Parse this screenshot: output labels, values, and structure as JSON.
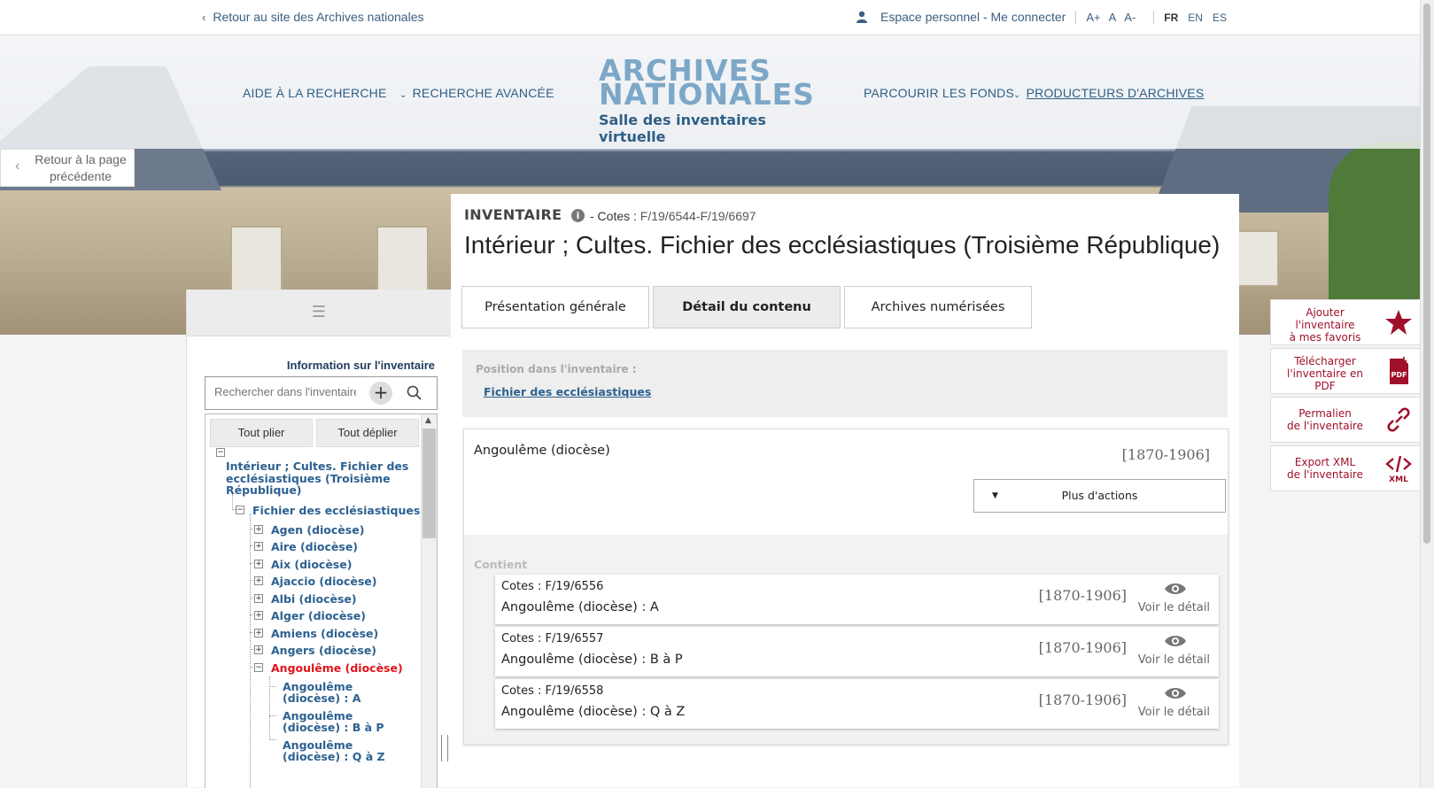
{
  "topbar": {
    "back_label": "Retour au site des Archives nationales",
    "account_label": "Espace personnel - Me connecter",
    "font_sizes": [
      "A+",
      "A",
      "A-"
    ],
    "languages": [
      "FR",
      "EN",
      "ES"
    ]
  },
  "nav": {
    "aide": "AIDE À LA RECHERCHE",
    "recherche_avancee": "RECHERCHE AVANCÉE",
    "parcourir": "PARCOURIR LES FONDS",
    "producteurs": "PRODUCTEURS D'ARCHIVES"
  },
  "logo": {
    "line1": "ARCHIVES",
    "line2": "NATIONALES",
    "subtitle": "Salle des inventaires virtuelle"
  },
  "prev_page": {
    "line1": "Retour à la page",
    "line2": "précédente"
  },
  "left_panel": {
    "info_link": "Information sur l'inventaire",
    "search_placeholder": "Rechercher dans l'inventaire",
    "collapse_all": "Tout plier",
    "expand_all": "Tout déplier",
    "tree_root": [
      "Intérieur ; Cultes. Fichier des",
      "ecclésiastiques (Troisième",
      "République)"
    ],
    "tree_level1": "Fichier des ecclésiastiques",
    "tree_items": [
      "Agen (diocèse)",
      "Aire (diocèse)",
      "Aix (diocèse)",
      "Ajaccio (diocèse)",
      "Albi (diocèse)",
      "Alger (diocèse)",
      "Amiens (diocèse)",
      "Angers (diocèse)",
      "Angoulême (diocèse)"
    ],
    "tree_sub_items": [
      [
        "Angoulême",
        "(diocèse) : A"
      ],
      [
        "Angoulême",
        "(diocèse) : B à P"
      ],
      [
        "Angoulême",
        "(diocèse) : Q à Z"
      ]
    ]
  },
  "main": {
    "kind": "INVENTAIRE",
    "cotes_label": "- Cotes :",
    "cotes_value": "F/19/6544-F/19/6697",
    "title": "Intérieur ; Cultes. Fichier des ecclésiastiques (Troisième République)",
    "tabs": [
      "Présentation générale",
      "Détail du contenu",
      "Archives numérisées"
    ],
    "position_label": "Position dans l'inventaire :",
    "position_link": "Fichier des ecclésiastiques",
    "record_title": "Angoulême (diocèse)",
    "record_date": "[1870-1906]",
    "more_actions": "Plus d'actions",
    "contient_label": "Contient",
    "children": [
      {
        "cotes": "Cotes : F/19/6556",
        "title": "Angoulême (diocèse) : A",
        "date": "[1870-1906]",
        "detail": "Voir le détail"
      },
      {
        "cotes": "Cotes : F/19/6557",
        "title": "Angoulême (diocèse) : B à P",
        "date": "[1870-1906]",
        "detail": "Voir le détail"
      },
      {
        "cotes": "Cotes : F/19/6558",
        "title": "Angoulême (diocèse) : Q à Z",
        "date": "[1870-1906]",
        "detail": "Voir le détail"
      }
    ]
  },
  "sidebar": {
    "favoris": [
      "Ajouter",
      "l'inventaire",
      "à mes favoris"
    ],
    "pdf": [
      "Télécharger",
      "l'inventaire en",
      "PDF"
    ],
    "permalien": [
      "Permalien",
      "de l'inventaire"
    ],
    "xml": [
      "Export XML",
      "de l'inventaire"
    ],
    "pdf_icon_text": "PDF",
    "xml_icon_text": "XML"
  },
  "colors": {
    "accent_blue": "#2d6190",
    "active_red": "#e0141b",
    "sidebar_red": "#a0102a"
  }
}
